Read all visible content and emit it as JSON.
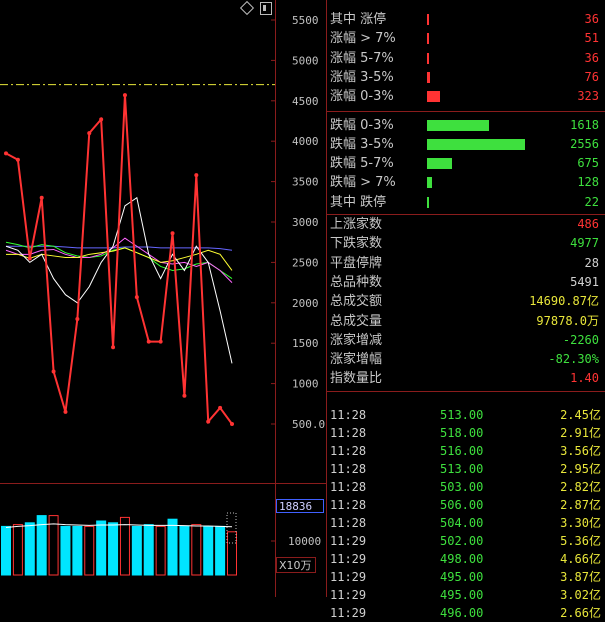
{
  "chart_data": {
    "type": "line",
    "ylim": [
      0,
      5800
    ],
    "y_ticks": [
      "5500",
      "5000",
      "4500",
      "4000",
      "3500",
      "3000",
      "2500",
      "2000",
      "1500",
      "1000",
      "500.0"
    ],
    "y_tick_values": [
      5500,
      5000,
      4500,
      4000,
      3500,
      3000,
      2500,
      2000,
      1500,
      1000,
      500
    ],
    "series": [
      {
        "color": "#ff3333",
        "values": [
          3850,
          3770,
          2550,
          3300,
          1150,
          650,
          1800,
          4100,
          4270,
          1450,
          4570,
          2070,
          1520,
          1520,
          2860,
          850,
          3580,
          530,
          700,
          500
        ]
      },
      {
        "color": "#ffffff",
        "values": [
          2700,
          2650,
          2500,
          2600,
          2300,
          2100,
          2000,
          2200,
          2500,
          2700,
          3200,
          3300,
          2600,
          2300,
          2600,
          2400,
          2700,
          2500,
          1900,
          1250
        ]
      },
      {
        "color": "#ffff33",
        "values": [
          2600,
          2600,
          2550,
          2600,
          2580,
          2560,
          2560,
          2600,
          2620,
          2640,
          2680,
          2620,
          2560,
          2500,
          2520,
          2560,
          2600,
          2650,
          2600,
          2400
        ]
      },
      {
        "color": "#ff66ff",
        "values": [
          2650,
          2600,
          2600,
          2650,
          2660,
          2600,
          2560,
          2560,
          2600,
          2680,
          2800,
          2700,
          2600,
          2500,
          2480,
          2500,
          2450,
          2500,
          2400,
          2250
        ]
      },
      {
        "color": "#33ff33",
        "values": [
          2750,
          2720,
          2680,
          2720,
          2700,
          2620,
          2580,
          2560,
          2580,
          2650,
          2680,
          2620,
          2560,
          2450,
          2400,
          2420,
          2480,
          2500,
          2400,
          2300
        ]
      },
      {
        "color": "#6666ff",
        "values": [
          2700,
          2700,
          2700,
          2700,
          2700,
          2690,
          2680,
          2680,
          2680,
          2680,
          2690,
          2690,
          2690,
          2680,
          2680,
          2680,
          2680,
          2680,
          2670,
          2650
        ]
      }
    ],
    "dash_level": 4700,
    "volume": {
      "ylim": [
        0,
        25000
      ],
      "values": [
        13500,
        14000,
        14500,
        16500,
        16500,
        13500,
        13500,
        13500,
        15000,
        14500,
        16000,
        13500,
        14000,
        13500,
        15500,
        13500,
        14000,
        13500,
        13500,
        12000
      ],
      "ma": [
        13200,
        13500,
        13700,
        14000,
        14200,
        14000,
        13900,
        13800,
        13900,
        13900,
        14000,
        13900,
        13800,
        13800,
        13800,
        13700,
        13600,
        13600,
        13500,
        13400
      ],
      "box_value": "18836",
      "tick": "10000",
      "unit": "X10万"
    }
  },
  "stats_up": [
    {
      "label": "其中 涨停",
      "value": "36",
      "bar": 0.015,
      "color": "#ff3333"
    },
    {
      "label": "涨幅 > 7%",
      "value": "51",
      "bar": 0.02,
      "color": "#ff3333"
    },
    {
      "label": "涨幅 5-7%",
      "value": "36",
      "bar": 0.015,
      "color": "#ff3333"
    },
    {
      "label": "涨幅 3-5%",
      "value": "76",
      "bar": 0.03,
      "color": "#ff3333"
    },
    {
      "label": "涨幅 0-3%",
      "value": "323",
      "bar": 0.13,
      "color": "#ff3333"
    }
  ],
  "stats_down": [
    {
      "label": "跌幅 0-3%",
      "value": "1618",
      "bar": 0.63,
      "color": "#3ee03e"
    },
    {
      "label": "跌幅 3-5%",
      "value": "2556",
      "bar": 1.0,
      "color": "#3ee03e"
    },
    {
      "label": "跌幅 5-7%",
      "value": "675",
      "bar": 0.26,
      "color": "#3ee03e"
    },
    {
      "label": "跌幅 > 7%",
      "value": "128",
      "bar": 0.05,
      "color": "#3ee03e"
    },
    {
      "label": "其中 跌停",
      "value": "22",
      "bar": 0.01,
      "color": "#3ee03e"
    }
  ],
  "summary": [
    {
      "label": "上涨家数",
      "value": "486",
      "color": "#ff3333"
    },
    {
      "label": "下跌家数",
      "value": "4977",
      "color": "#3ee03e"
    },
    {
      "label": "平盘停牌",
      "value": "28",
      "color": "#d0d0d0"
    },
    {
      "label": "总品种数",
      "value": "5491",
      "color": "#d0d0d0"
    },
    {
      "label": "总成交额",
      "value": "14690.87亿",
      "color": "#e8e63a"
    },
    {
      "label": "总成交量",
      "value": "97878.0万",
      "color": "#e8e63a"
    },
    {
      "label": "涨家增减",
      "value": "-2260",
      "color": "#3ee03e"
    },
    {
      "label": "涨家增幅",
      "value": "-82.30%",
      "color": "#3ee03e"
    },
    {
      "label": "指数量比",
      "value": "1.40",
      "color": "#ff3333"
    }
  ],
  "trades": [
    {
      "time": "11:28",
      "price": "513.00",
      "amount": "2.45",
      "unit": "亿"
    },
    {
      "time": "11:28",
      "price": "518.00",
      "amount": "2.91",
      "unit": "亿"
    },
    {
      "time": "11:28",
      "price": "516.00",
      "amount": "3.56",
      "unit": "亿"
    },
    {
      "time": "11:28",
      "price": "513.00",
      "amount": "2.95",
      "unit": "亿"
    },
    {
      "time": "11:28",
      "price": "503.00",
      "amount": "2.82",
      "unit": "亿"
    },
    {
      "time": "11:28",
      "price": "506.00",
      "amount": "2.87",
      "unit": "亿"
    },
    {
      "time": "11:28",
      "price": "504.00",
      "amount": "3.30",
      "unit": "亿"
    },
    {
      "time": "11:29",
      "price": "502.00",
      "amount": "5.36",
      "unit": "亿"
    },
    {
      "time": "11:29",
      "price": "498.00",
      "amount": "4.66",
      "unit": "亿"
    },
    {
      "time": "11:29",
      "price": "495.00",
      "amount": "3.87",
      "unit": "亿"
    },
    {
      "time": "11:29",
      "price": "495.00",
      "amount": "3.02",
      "unit": "亿"
    },
    {
      "time": "11:29",
      "price": "496.00",
      "amount": "2.66",
      "unit": "亿"
    }
  ]
}
